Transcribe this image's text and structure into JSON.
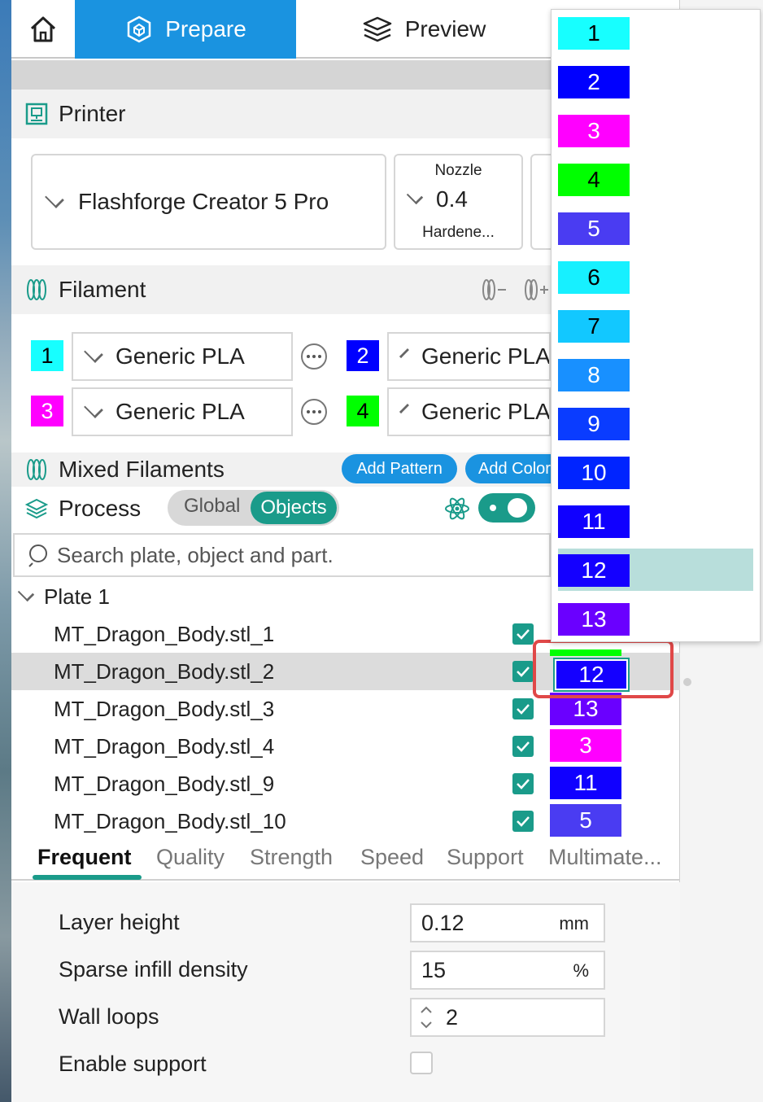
{
  "tabs": {
    "prepare": "Prepare",
    "preview": "Preview"
  },
  "printer": {
    "title": "Printer",
    "model": "Flashforge Creator 5 Pro",
    "nozzle_label": "Nozzle",
    "nozzle_value": "0.4",
    "nozzle_type": "Hardene..."
  },
  "filament": {
    "title": "Filament",
    "slots": [
      {
        "id": "1",
        "name": "Generic PLA",
        "color": "#17ffff",
        "text": "#000000"
      },
      {
        "id": "2",
        "name": "Generic PLA",
        "color": "#0000ff",
        "text": "#ffffff"
      },
      {
        "id": "3",
        "name": "Generic PLA",
        "color": "#ff00ff",
        "text": "#ffffff"
      },
      {
        "id": "4",
        "name": "Generic PLA",
        "color": "#00ff00",
        "text": "#000000"
      }
    ]
  },
  "mixed": {
    "title": "Mixed Filaments",
    "add_pattern": "Add Pattern",
    "add_color": "Add Color"
  },
  "process": {
    "title": "Process",
    "global": "Global",
    "objects": "Objects"
  },
  "search": {
    "placeholder": "Search plate, object and part."
  },
  "tree": {
    "plate": "Plate 1",
    "objects": [
      {
        "name": "MT_Dragon_Body.stl_1",
        "color_id": "",
        "color": ""
      },
      {
        "name": "MT_Dragon_Body.stl_2",
        "color_id": "12",
        "color": "#1400ff"
      },
      {
        "name": "MT_Dragon_Body.stl_3",
        "color_id": "13",
        "color": "#6a00ff"
      },
      {
        "name": "MT_Dragon_Body.stl_4",
        "color_id": "3",
        "color": "#ff00ff"
      },
      {
        "name": "MT_Dragon_Body.stl_9",
        "color_id": "11",
        "color": "#1000ff"
      },
      {
        "name": "MT_Dragon_Body.stl_10",
        "color_id": "5",
        "color": "#4a3cf2"
      }
    ]
  },
  "settings_tabs": [
    "Frequent",
    "Quality",
    "Strength",
    "Speed",
    "Support",
    "Multimate..."
  ],
  "settings": {
    "layer_height": {
      "label": "Layer height",
      "value": "0.12",
      "unit": "mm"
    },
    "infill": {
      "label": "Sparse infill density",
      "value": "15",
      "unit": "%"
    },
    "walls": {
      "label": "Wall loops",
      "value": "2"
    },
    "support": {
      "label": "Enable support"
    }
  },
  "dropdown": {
    "items": [
      {
        "id": "1",
        "color": "#17ffff",
        "text": "#000000"
      },
      {
        "id": "2",
        "color": "#0000ff",
        "text": "#ffffff"
      },
      {
        "id": "3",
        "color": "#ff00ff",
        "text": "#ffffff"
      },
      {
        "id": "4",
        "color": "#00ff00",
        "text": "#000000"
      },
      {
        "id": "5",
        "color": "#4a3cf2",
        "text": "#ffffff"
      },
      {
        "id": "6",
        "color": "#17f0ff",
        "text": "#000000"
      },
      {
        "id": "7",
        "color": "#12c8ff",
        "text": "#000000"
      },
      {
        "id": "8",
        "color": "#1890ff",
        "text": "#ffffff"
      },
      {
        "id": "9",
        "color": "#0a3cff",
        "text": "#ffffff"
      },
      {
        "id": "10",
        "color": "#0024ff",
        "text": "#ffffff"
      },
      {
        "id": "11",
        "color": "#1000ff",
        "text": "#ffffff"
      },
      {
        "id": "12",
        "color": "#1400ff",
        "text": "#ffffff"
      },
      {
        "id": "13",
        "color": "#6a00ff",
        "text": "#ffffff"
      }
    ],
    "highlight_color": "#b8dedb"
  },
  "colors": {
    "accent": "#1a93e0",
    "teal": "#1a9b8a",
    "callout": "#e04848"
  }
}
